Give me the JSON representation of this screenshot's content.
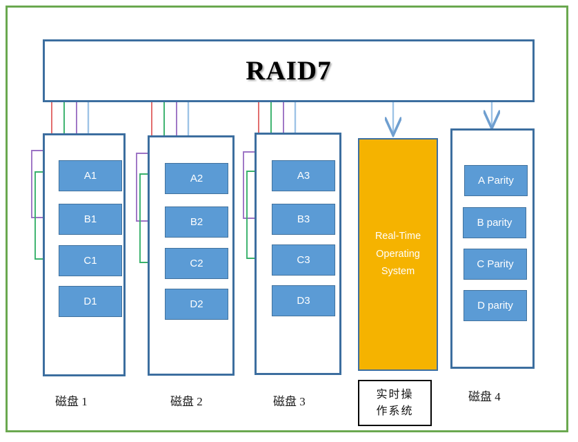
{
  "frame": {
    "border_color": "#6aa84f"
  },
  "header": {
    "title": "RAID7",
    "box_border_color": "#3c6e9f"
  },
  "palette": {
    "block_fill": "#5b9bd5",
    "block_border": "#41719c",
    "rtos_fill": "#f5b300",
    "wire_red": "#e06666",
    "wire_green": "#37b06a",
    "wire_purple": "#9b72c4",
    "wire_blue": "#9dc3e6",
    "arrow_red": "#cc0000",
    "arrow_green": "#00a14b",
    "arrow_purple": "#6a1f9c",
    "arrow_blue": "#5b9bd5"
  },
  "disks": [
    {
      "label": "磁盘 1",
      "blocks": [
        {
          "text": "A1"
        },
        {
          "text": "B1"
        },
        {
          "text": "C1"
        },
        {
          "text": "D1"
        }
      ]
    },
    {
      "label": "磁盘 2",
      "blocks": [
        {
          "text": "A2"
        },
        {
          "text": "B2"
        },
        {
          "text": "C2"
        },
        {
          "text": "D2"
        }
      ]
    },
    {
      "label": "磁盘 3",
      "blocks": [
        {
          "text": "A3"
        },
        {
          "text": "B3"
        },
        {
          "text": "C3"
        },
        {
          "text": "D3"
        }
      ]
    },
    {
      "label": "磁盘 4",
      "blocks": [
        {
          "text": "A Parity"
        },
        {
          "text": "B parity"
        },
        {
          "text": "C Parity"
        },
        {
          "text": "D parity"
        }
      ]
    }
  ],
  "rtos": {
    "line1": "Real-Time",
    "line2": "Operating",
    "line3": "System",
    "caption_line1": "实时操",
    "caption_line2": "作系统"
  }
}
